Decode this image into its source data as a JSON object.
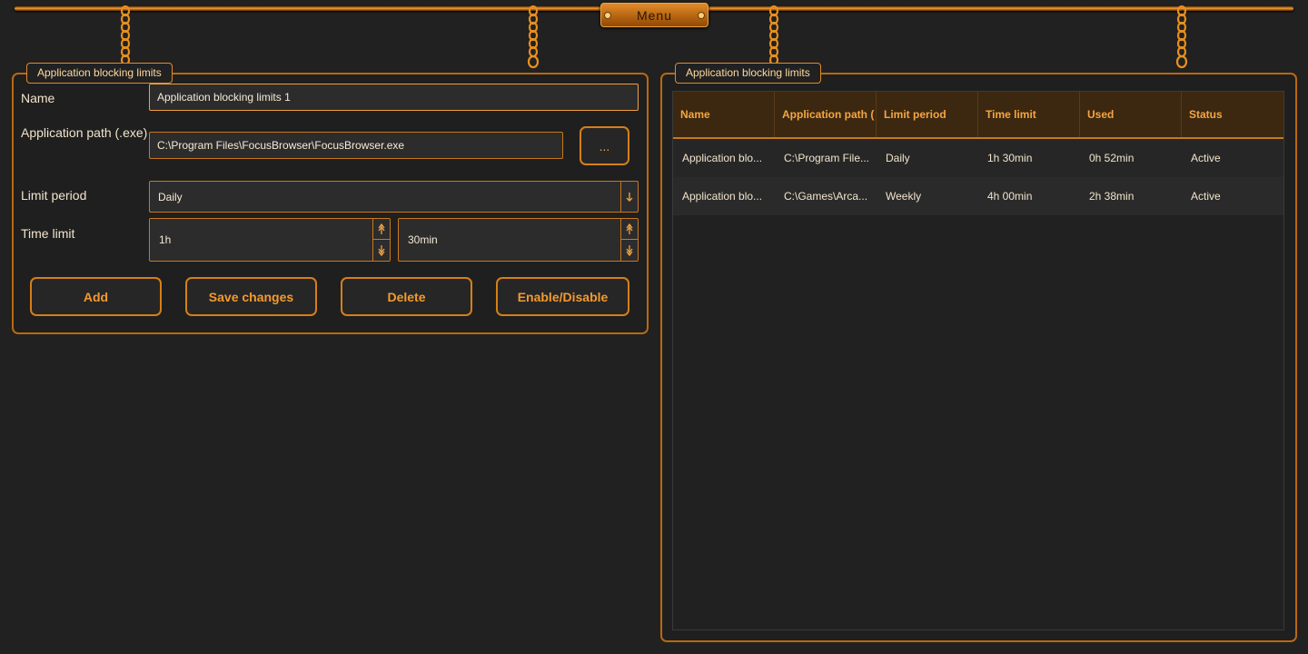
{
  "menu": {
    "label": "Menu"
  },
  "editor": {
    "group_title": "Application blocking limits",
    "name_label": "Name",
    "name_value": "Application blocking limits 1",
    "path_label": "Application path (.exe)",
    "path_value": "C:\\Program Files\\FocusBrowser\\FocusBrowser.exe",
    "browse_label": "...",
    "period_label": "Limit period",
    "period_value": "Daily",
    "time_label": "Time limit",
    "hours_value": "1h",
    "minutes_value": "30min",
    "buttons": {
      "add": "Add",
      "save": "Save changes",
      "delete": "Delete",
      "toggle": "Enable/Disable"
    }
  },
  "list": {
    "group_title": "Application blocking limits",
    "columns": [
      "Name",
      "Application path (",
      "Limit period",
      "Time limit",
      "Used",
      "Status"
    ],
    "rows": [
      [
        "Application blo...",
        "C:\\Program File...",
        "Daily",
        "1h 30min",
        "0h 52min",
        "Active"
      ],
      [
        "Application blo...",
        "C:\\Games\\Arca...",
        "Weekly",
        "4h 00min",
        "2h 38min",
        "Active"
      ]
    ]
  },
  "icons": {
    "dropdown": "chevron-down-icon",
    "spin_up": "arrow-up-icon",
    "spin_down": "arrow-down-icon"
  },
  "colors": {
    "accent": "#f39a2e",
    "background": "#212121",
    "border": "#c8781c"
  }
}
